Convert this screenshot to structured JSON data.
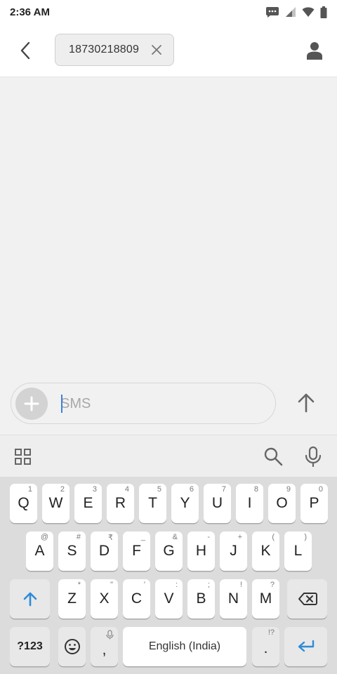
{
  "status_bar": {
    "time": "2:36 AM"
  },
  "header": {
    "recipient": "18730218809"
  },
  "compose": {
    "placeholder": "SMS"
  },
  "keyboard": {
    "row1": [
      {
        "label": "Q",
        "hint": "1"
      },
      {
        "label": "W",
        "hint": "2"
      },
      {
        "label": "E",
        "hint": "3"
      },
      {
        "label": "R",
        "hint": "4"
      },
      {
        "label": "T",
        "hint": "5"
      },
      {
        "label": "Y",
        "hint": "6"
      },
      {
        "label": "U",
        "hint": "7"
      },
      {
        "label": "I",
        "hint": "8"
      },
      {
        "label": "O",
        "hint": "9"
      },
      {
        "label": "P",
        "hint": "0"
      }
    ],
    "row2": [
      {
        "label": "A",
        "hint": "@"
      },
      {
        "label": "S",
        "hint": "#"
      },
      {
        "label": "D",
        "hint": "₹"
      },
      {
        "label": "F",
        "hint": "_"
      },
      {
        "label": "G",
        "hint": "&"
      },
      {
        "label": "H",
        "hint": "-"
      },
      {
        "label": "J",
        "hint": "+"
      },
      {
        "label": "K",
        "hint": "("
      },
      {
        "label": "L",
        "hint": ")"
      }
    ],
    "row3": [
      {
        "label": "Z",
        "hint": "*"
      },
      {
        "label": "X",
        "hint": "\""
      },
      {
        "label": "C",
        "hint": "'"
      },
      {
        "label": "V",
        "hint": ":"
      },
      {
        "label": "B",
        "hint": ";"
      },
      {
        "label": "N",
        "hint": "!"
      },
      {
        "label": "M",
        "hint": "?"
      }
    ],
    "symbols_label": "?123",
    "comma_label": ",",
    "space_label": "English (India)",
    "period_label": ".",
    "period_hint": "!?"
  },
  "icons": {
    "back": "back-arrow-icon",
    "chip_close": "close-icon",
    "contact": "person-icon",
    "attach": "plus-icon",
    "send": "up-arrow-icon",
    "apps": "grid-icon",
    "search": "search-icon",
    "mic": "mic-icon",
    "shift": "shift-icon",
    "backspace": "backspace-icon",
    "emoji": "emoji-icon",
    "enter": "enter-icon"
  },
  "colors": {
    "accent": "#3b84d8",
    "background": "#f1f1f1",
    "keyboard_bg": "#dcdcdc",
    "key_bg": "#ffffff"
  }
}
